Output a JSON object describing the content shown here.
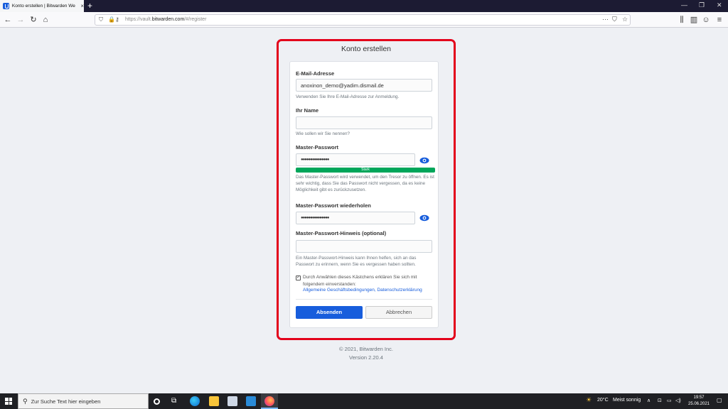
{
  "browser": {
    "tab_title": "Konto erstellen | Bitwarden We",
    "tab_close": "×",
    "new_tab": "+",
    "url_prefix": "https://vault.",
    "url_domain": "bitwarden.com",
    "url_suffix": "/#/register"
  },
  "form": {
    "title": "Konto erstellen",
    "email_label": "E-Mail-Adresse",
    "email_value": "anoxinon_demo@yadim.dismail.de",
    "email_hint": "Verwenden Sie Ihre E-Mail-Adresse zur Anmeldung.",
    "name_label": "Ihr Name",
    "name_value": "",
    "name_hint": "Wie sollen wir Sie nennen?",
    "password_label": "Master-Passwort",
    "password_value": "●●●●●●●●●●●●●●●",
    "strength_label": "Stark",
    "strength_level": 1.0,
    "password_hint": "Das Master-Passwort wird verwendet, um den Tresor zu öffnen. Es ist sehr wichtig, dass Sie das Passwort nicht vergessen, da es keine Möglichkeit gibt es zurückzusetzen.",
    "repeat_label": "Master-Passwort wiederholen",
    "repeat_value": "●●●●●●●●●●●●●●●",
    "hint_label": "Master-Passwort-Hinweis (optional)",
    "hint_value": "",
    "hint_hint": "Ein Master-Passwort-Hinweis kann Ihnen helfen, sich an das Passwort zu erinnern, wenn Sie es vergessen haben sollten.",
    "checkbox_checked": true,
    "terms_text": "Durch Anwählen dieses Kästchens erklären Sie sich mit folgendem einverstanden:",
    "terms_link": "Allgemeine Geschäftsbedingungen",
    "terms_separator": ", ",
    "privacy_link": "Datenschutzerklärung",
    "submit_label": "Absenden",
    "cancel_label": "Abbrechen"
  },
  "footer": {
    "copyright": "© 2021, Bitwarden Inc.",
    "version": "Version 2.20.4"
  },
  "taskbar": {
    "search_placeholder": "Zur Suche Text hier eingeben",
    "temperature": "20°C",
    "weather": "Meist sonnig",
    "time": "19:57",
    "date": "25.06.2021"
  },
  "colors": {
    "accent": "#175ddc",
    "highlight": "#e3001b",
    "strength": "#00a65a"
  }
}
